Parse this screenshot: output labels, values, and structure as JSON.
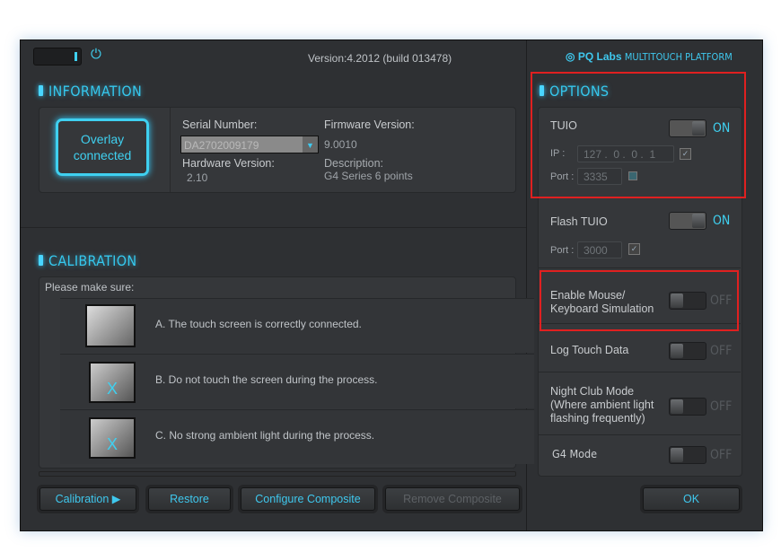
{
  "header": {
    "version": "Version:4.2012 (build 013478)",
    "brand": "PQ Labs",
    "platform": "MULTITOUCH PLATFORM"
  },
  "information": {
    "title": "INFORMATION",
    "status": "Overlay connected",
    "serial_label": "Serial Number:",
    "serial_value": "DA2702009179",
    "firmware_label": "Firmware Version:",
    "firmware_value": "9.0010",
    "hardware_label": "Hardware Version:",
    "hardware_value": "2.10",
    "description_label": "Description:",
    "description_value": "G4 Series 6 points"
  },
  "calibration": {
    "title": "CALIBRATION",
    "intro": "Please make sure:",
    "items": [
      "A.  The touch screen is correctly connected.",
      "B.  Do not touch the screen during the process.",
      "C.  No strong ambient light during the process."
    ]
  },
  "buttons": {
    "calibration": "Calibration",
    "restore": "Restore",
    "configure": "Configure Composite",
    "remove": "Remove Composite",
    "ok": "OK"
  },
  "options": {
    "title": "OPTIONS",
    "tuio": {
      "label": "TUIO",
      "state": "ON",
      "ip_label": "IP :",
      "ip": [
        "127",
        "0",
        "0",
        "1"
      ],
      "port_label": "Port :",
      "port": "3335"
    },
    "flash": {
      "label": "Flash TUIO",
      "state": "ON",
      "port_label": "Port :",
      "port": "3000"
    },
    "mouse": {
      "label": "Enable Mouse/ Keyboard Simulation",
      "state": "OFF"
    },
    "log": {
      "label": "Log Touch Data",
      "state": "OFF"
    },
    "night": {
      "label": "Night Club Mode (Where ambient light flashing frequently)",
      "state": "OFF"
    },
    "g4": {
      "label": "G4 Mode",
      "state": "OFF"
    }
  },
  "colors": {
    "accent": "#3fd0f0",
    "highlight": "#e02020"
  }
}
